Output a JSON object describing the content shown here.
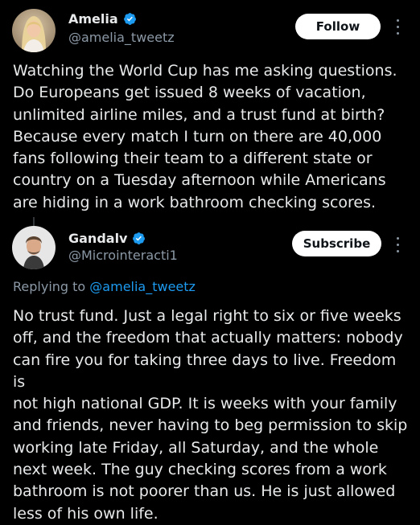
{
  "colors": {
    "background": "#000000",
    "text_primary": "#e7e9ea",
    "text_secondary": "#8b98a5",
    "accent": "#1d9bf0",
    "button_bg": "#ffffff",
    "button_text": "#0f1419"
  },
  "original_tweet": {
    "author": {
      "display_name": "Amelia",
      "handle": "@amelia_tweetz",
      "verified_icon": "verified-badge-icon",
      "avatar": "user-avatar"
    },
    "follow_label": "Follow",
    "more_icon": "more-options-icon",
    "text": "Watching the World Cup has me asking questions.\nDo Europeans get issued 8 weeks of vacation,\nunlimited airline miles, and a trust fund at birth?\nBecause every match I turn on there are 40,000\nfans following their team to a different state or\ncountry on a Tuesday afternoon while Americans\nare hiding in a work bathroom checking scores."
  },
  "reply_tweet": {
    "author": {
      "display_name": "Gandalv",
      "handle": "@Microinteracti1",
      "verified_icon": "verified-badge-icon",
      "avatar": "user-avatar"
    },
    "subscribe_label": "Subscribe",
    "more_icon": "more-options-icon",
    "replying_prefix": "Replying to ",
    "replying_handle": "@amelia_tweetz",
    "text": "No trust fund. Just a legal right to six or five weeks\noff, and the freedom that actually matters: nobody\ncan fire you for taking three days to live. Freedom is\nnot high national GDP. It is weeks with your family\nand friends, never having to beg permission to skip\nworking late Friday, all Saturday, and the whole\nnext week. The guy checking scores from a work\nbathroom is not poorer than us. He is just allowed\nless of his own life."
  }
}
